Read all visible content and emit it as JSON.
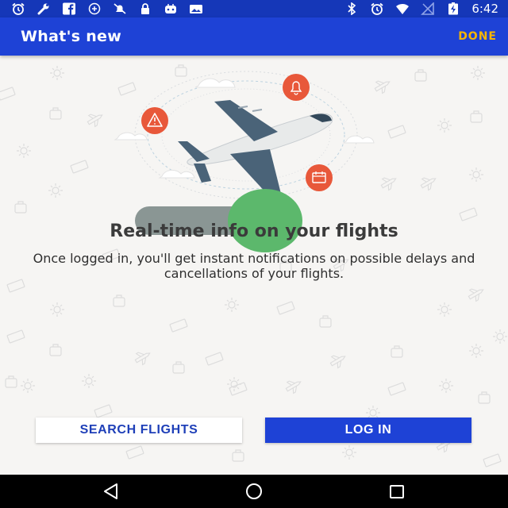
{
  "status_bar": {
    "time": "6:42",
    "left_icons": [
      "alarm-icon",
      "wrench-icon",
      "facebook-icon",
      "data-saver-icon",
      "no-notifications-icon",
      "lock-icon",
      "game-controller-icon",
      "photo-messages-icon"
    ],
    "right_icons": [
      "bluetooth-icon",
      "alarm-icon",
      "wifi-icon",
      "signal-off-icon",
      "battery-charging-icon"
    ]
  },
  "app_bar": {
    "title": "What's new",
    "done_label": "DONE"
  },
  "illustration": {
    "icons": [
      "warning-icon",
      "bell-icon",
      "calendar-icon",
      "airplane-icon"
    ],
    "colors": {
      "badge": "#e8583a",
      "plane_body": "#e8eaea",
      "plane_wing": "#4a6378"
    }
  },
  "pager": {
    "colors": {
      "track": "#8a9694",
      "dot": "#5cb86c"
    }
  },
  "main": {
    "headline": "Real-time info on your flights",
    "body": "Once logged in, you'll get instant notifications on possible delays and cancellations of your flights."
  },
  "buttons": {
    "search_flights": "SEARCH FLIGHTS",
    "log_in": "LOG IN"
  },
  "nav_bar": {
    "icons": [
      "back-icon",
      "home-icon",
      "recents-icon"
    ]
  },
  "colors": {
    "primary": "#1e42d6",
    "status_bar": "#1537b8",
    "accent": "#f7b500",
    "background": "#f6f5f3"
  }
}
